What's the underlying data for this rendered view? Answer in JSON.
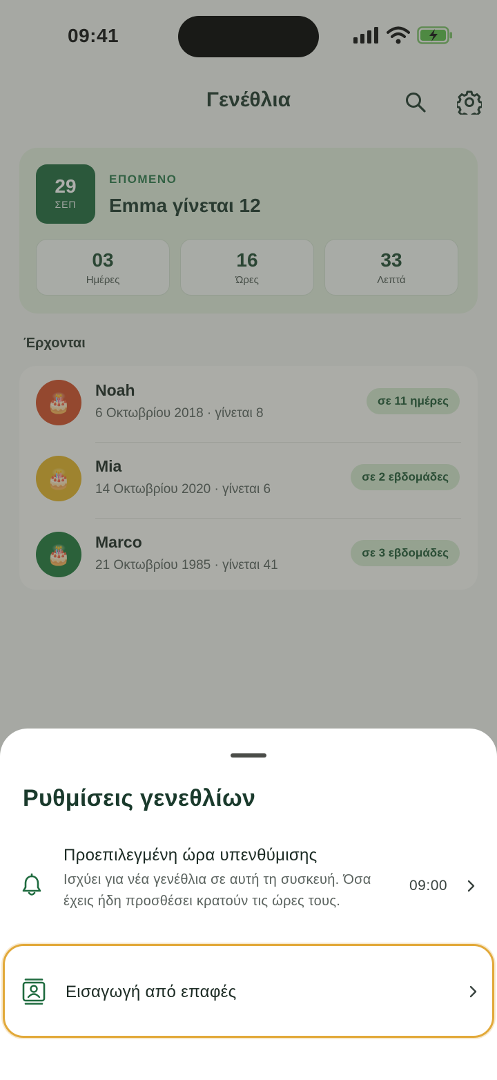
{
  "status": {
    "time": "09:41"
  },
  "header": {
    "title": "Γενέθλια"
  },
  "next": {
    "label": "ΕΠΟΜΕΝΟ",
    "day": "29",
    "month": "ΣΕΠ",
    "title": "Emma γίνεται 12",
    "counters": [
      {
        "value": "03",
        "label": "Ημέρες"
      },
      {
        "value": "16",
        "label": "Ώρες"
      },
      {
        "value": "33",
        "label": "Λεπτά"
      }
    ]
  },
  "upcoming": {
    "title": "Έρχονται",
    "items": [
      {
        "name": "Noah",
        "sub": "6 Οκτωβρίου 2018 · γίνεται 8",
        "pill": "σε 11 ημέρες",
        "color": "#d4502a"
      },
      {
        "name": "Mia",
        "sub": "14 Οκτωβρίου 2020 · γίνεται 6",
        "pill": "σε 2 εβδομάδες",
        "color": "#e6b62a"
      },
      {
        "name": "Marco",
        "sub": "21 Οκτωβρίου 1985 · γίνεται 41",
        "pill": "σε 3 εβδομάδες",
        "color": "#1f7a3d"
      }
    ]
  },
  "sheet": {
    "title": "Ρυθμίσεις γενεθλίων",
    "reminder": {
      "title": "Προεπιλεγμένη ώρα υπενθύμισης",
      "description": "Ισχύει για νέα γενέθλια σε αυτή τη συσκευή. Όσα έχεις ήδη προσθέσει κρατούν τις ώρες τους.",
      "value": "09:00"
    },
    "import": {
      "title": "Εισαγωγή από επαφές"
    }
  },
  "colors": {
    "accent": "#1f6b3f",
    "highlight": "#e2a93a"
  }
}
